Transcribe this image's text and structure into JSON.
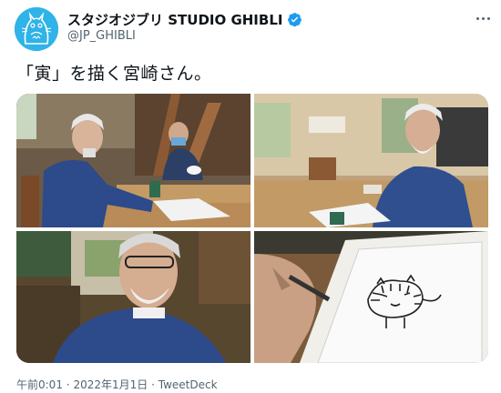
{
  "account": {
    "display_name": "スタジオジブリ STUDIO GHIBLI",
    "handle": "@JP_GHIBLI",
    "verified": true,
    "avatar_icon": "totoro-avatar-icon",
    "accent_color": "#1d9bf0"
  },
  "tweet": {
    "text": "「寅」を描く宮崎さん。",
    "more_icon": "more-options-icon"
  },
  "media": {
    "photo_count": 4
  },
  "meta": {
    "time": "午前0:01",
    "separator1": "·",
    "date": "2022年1月1日",
    "separator2": "·",
    "source": "TweetDeck"
  }
}
